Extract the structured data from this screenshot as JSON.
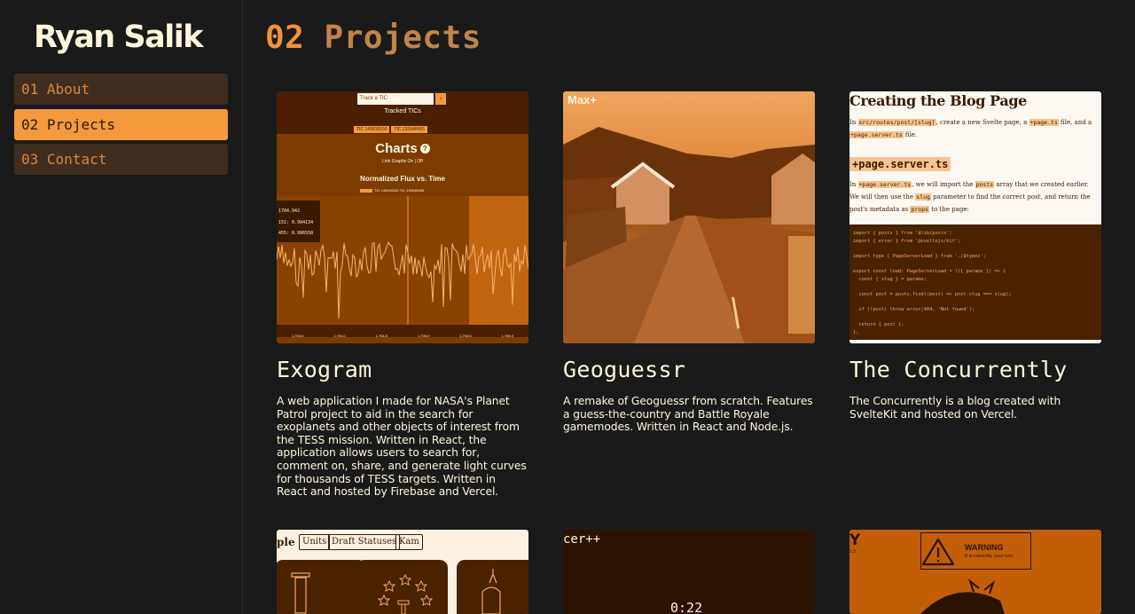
{
  "brand": "Ryan Salik",
  "nav": [
    {
      "num": "01",
      "label": "About"
    },
    {
      "num": "02",
      "label": "Projects"
    },
    {
      "num": "03",
      "label": "Contact"
    }
  ],
  "page": {
    "num": "02",
    "title": "Projects"
  },
  "colors": {
    "background": "#1a1a1a",
    "accent": "#f29a3c",
    "text": "#fdf6da",
    "nav_inactive": "#3f2e1f"
  },
  "projects": [
    {
      "title": "Exogram",
      "description": "A web application I made for NASA's Planet Patrol project to aid in the search for exoplanets and other objects of interest from the TESS mission. Written in React, the application allows users to search for, comment on, share, and generate light curves for thousands of TESS targets. Written in React and hosted by Firebase and Vercel.",
      "thumb": {
        "search_placeholder": "Track a TIC",
        "tracked_label": "Tracked TICs",
        "chips": [
          "TIC 149918150",
          "TIC 233948455"
        ],
        "charts_label": "Charts",
        "toggle_label": "Link Graphs On  |  Off",
        "chart_title": "Normalized Flux vs. Time",
        "legend": "TIC 149918150   TIC 233948455",
        "tooltip": [
          "1704.942",
          "151: 0.994134",
          "455: 0.996558"
        ],
        "ticks": [
          "1,703.5",
          "1,704.0",
          "1,704.5",
          "1,705.0",
          "1,705.5",
          "1,706.0"
        ]
      }
    },
    {
      "title": "Geoguessr",
      "description": "A remake of Geoguessr from scratch. Features a guess-the-country and Battle Royale gamemodes. Written in React and Node.js.",
      "thumb": {
        "logo": "Max+"
      }
    },
    {
      "title": "The Concurrently",
      "description": "The Concurrently is a blog created with SvelteKit and hosted on Vercel.",
      "thumb": {
        "heading": "Creating the Blog Page",
        "para1_a": "In ",
        "para1_code1": "src/routes/post/[slug]",
        "para1_b": ", create a new Svelte page, a ",
        "para1_code2": "+page.ts",
        "para1_c": " file, and a",
        "para1_code3": "+page.server.ts",
        "para1_d": " file.",
        "subheading": "+page.server.ts",
        "para2_a": "In ",
        "para2_code1": "+page.server.ts",
        "para2_b": ", we will import the ",
        "para2_code2": "posts",
        "para2_c": " array that we created earlier. We will then use the ",
        "para2_code3": "slug",
        "para2_d": " parameter to find the correct post, and return the post's metadata as ",
        "para2_code4": "props",
        "para2_e": " to the page:",
        "code": "import { posts } from '$lib/posts';\nimport { error } from '@sveltejs/kit';\n\nimport type { PageServerLoad } from './$types';\n\nexport const load: PageServerLoad = (({ params }) => {\n  const { slug } = params;\n\n  const post = posts.find((post) => post.slug === slug);\n\n  if (!post) throw error(404, 'Not found');\n\n  return { post };\n};"
      }
    }
  ],
  "row2": {
    "states": {
      "word": "ple",
      "tabs": [
        "Units",
        "Draft Statuses",
        "Kam"
      ]
    },
    "soccer": {
      "title": "cer++",
      "clock": "0:22"
    },
    "tictac": {
      "letter": "Y",
      "sub": "1.3",
      "warning": "WARNING",
      "warning_sub": "It is currently your turn"
    }
  }
}
